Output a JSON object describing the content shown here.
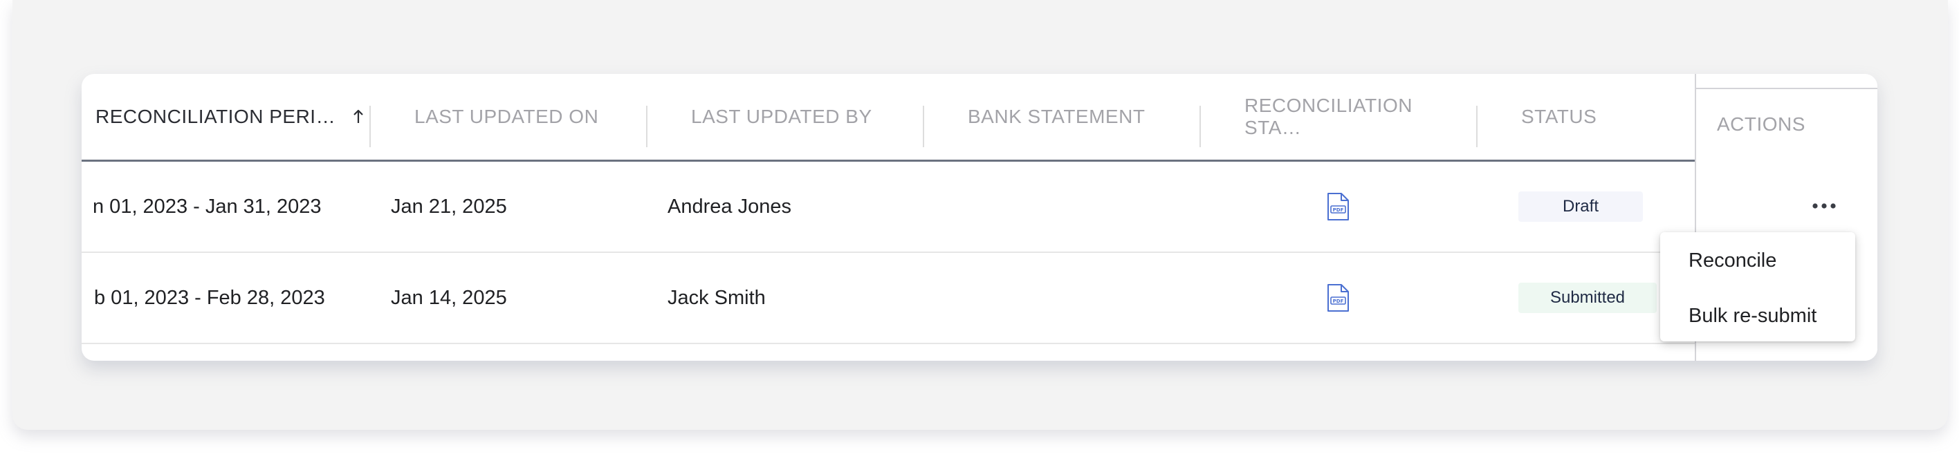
{
  "table": {
    "columns": [
      {
        "label": "RECONCILIATION PERI…",
        "sort_icon": "arrow-up-icon"
      },
      {
        "label": "LAST UPDATED ON"
      },
      {
        "label": "LAST UPDATED BY"
      },
      {
        "label": "BANK STATEMENT"
      },
      {
        "label": "RECONCILIATION STA…"
      },
      {
        "label": "STATUS"
      },
      {
        "label": "ACTIONS"
      }
    ],
    "rows": [
      {
        "period": "n 01, 2023 - Jan 31, 2023",
        "updated_on": "Jan 21, 2025",
        "updated_by": "Andrea Jones",
        "bank_statement": "",
        "reconciliation_statement_icon": "pdf-file-icon",
        "status": "Draft",
        "actions_icon": "more-horizontal-icon"
      },
      {
        "period": "b 01, 2023 - Feb 28, 2023",
        "updated_on": "Jan 14, 2025",
        "updated_by": "Jack Smith",
        "bank_statement": "",
        "reconciliation_statement_icon": "pdf-file-icon",
        "status": "Submitted",
        "actions_icon": "more-horizontal-icon"
      }
    ]
  },
  "actions_menu": {
    "items": [
      {
        "label": "Reconcile"
      },
      {
        "label": "Bulk re-submit"
      }
    ]
  },
  "colors": {
    "header_text": "#a3a3a8",
    "body_text": "#202124",
    "draft_badge_bg": "#f4f5fb",
    "submitted_badge_bg": "#eef8f2",
    "pdf_icon": "#4a6fd1"
  }
}
